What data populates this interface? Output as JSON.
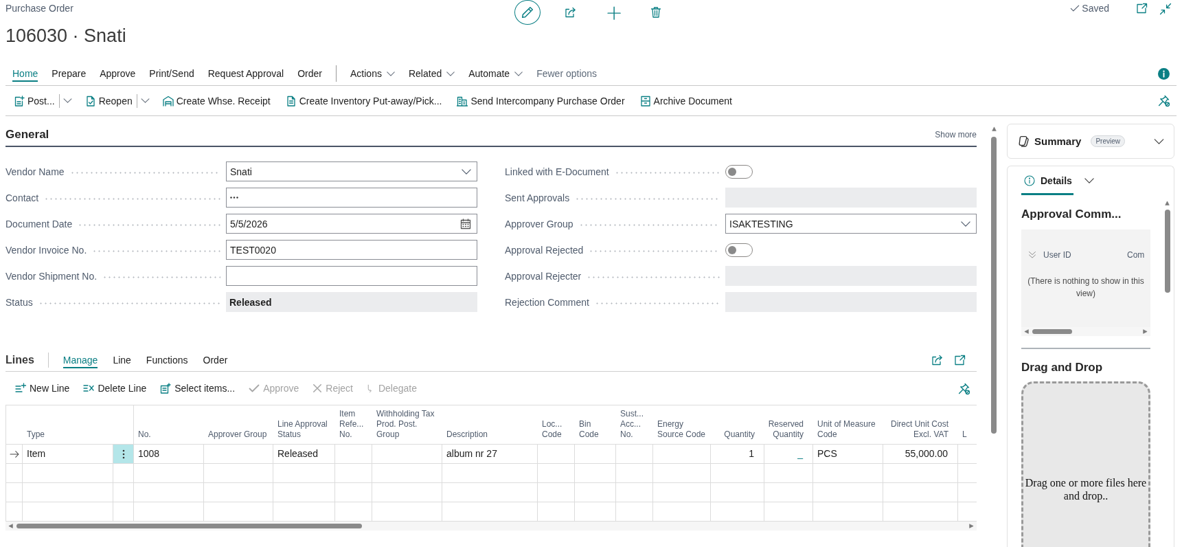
{
  "header": {
    "caption": "Purchase Order",
    "title": "106030 · Snati",
    "save_status": "Saved"
  },
  "tabs": [
    {
      "label": "Home",
      "kind": "tab",
      "selected": true
    },
    {
      "label": "Prepare",
      "kind": "tab",
      "selected": false
    },
    {
      "label": "Approve",
      "kind": "tab",
      "selected": false
    },
    {
      "label": "Print/Send",
      "kind": "tab",
      "selected": false
    },
    {
      "label": "Request Approval",
      "kind": "tab",
      "selected": false
    },
    {
      "label": "Order",
      "kind": "tab",
      "selected": false
    },
    {
      "label": "Actions",
      "kind": "menu",
      "selected": false
    },
    {
      "label": "Related",
      "kind": "menu",
      "selected": false
    },
    {
      "label": "Automate",
      "kind": "menu",
      "selected": false
    },
    {
      "label": "Fewer options",
      "kind": "toggle",
      "selected": false
    }
  ],
  "actions": [
    {
      "label": "Post...",
      "split": true
    },
    {
      "label": "Reopen",
      "split": true
    },
    {
      "label": "Create Whse. Receipt",
      "split": false
    },
    {
      "label": "Create Inventory Put-away/Pick...",
      "split": false
    },
    {
      "label": "Send Intercompany Purchase Order",
      "split": false
    },
    {
      "label": "Archive Document",
      "split": false
    }
  ],
  "general": {
    "title": "General",
    "show_more": "Show more",
    "field_columns": [
      {
        "fields": [
          {
            "label": "Vendor Name",
            "kind": "dropdown",
            "value": "Snati"
          },
          {
            "label": "Contact",
            "kind": "lookup"
          },
          {
            "label": "Document Date",
            "kind": "date",
            "value": "5/5/2026"
          },
          {
            "label": "Vendor Invoice No.",
            "kind": "text",
            "value": "TEST0020"
          },
          {
            "label": "Vendor Shipment No.",
            "kind": "text"
          },
          {
            "label": "Status",
            "kind": "readonly",
            "value": "Released"
          }
        ]
      },
      {
        "fields": [
          {
            "label": "Linked with E-Document",
            "kind": "toggle",
            "on": false
          },
          {
            "label": "Sent Approvals",
            "kind": "readonly"
          },
          {
            "label": "Approver Group",
            "kind": "dropdown",
            "value": "ISAKTESTING"
          },
          {
            "label": "Approval Rejected",
            "kind": "toggle",
            "on": false
          },
          {
            "label": "Approval Rejecter",
            "kind": "readonly"
          },
          {
            "label": "Rejection Comment",
            "kind": "readonly"
          }
        ]
      }
    ]
  },
  "lines": {
    "title": "Lines",
    "tabs": [
      {
        "label": "Manage",
        "selected": true
      },
      {
        "label": "Line",
        "selected": false
      },
      {
        "label": "Functions",
        "selected": false
      },
      {
        "label": "Order",
        "selected": false
      }
    ],
    "actions": [
      {
        "label": "New Line",
        "disabled": false
      },
      {
        "label": "Delete Line",
        "disabled": false
      },
      {
        "label": "Select items...",
        "disabled": false
      },
      {
        "label": "Approve",
        "disabled": true
      },
      {
        "label": "Reject",
        "disabled": true
      },
      {
        "label": "Delegate",
        "disabled": true
      }
    ],
    "columns": [
      {
        "label": "Type",
        "kind": "text"
      },
      {
        "label": "No.",
        "kind": "text"
      },
      {
        "label": "Approver Group",
        "kind": "text"
      },
      {
        "label": "Line Approval Status",
        "kind": "text"
      },
      {
        "label": "Item Refe... No.",
        "kind": "text"
      },
      {
        "label": "Withholding Tax Prod. Post. Group",
        "kind": "text"
      },
      {
        "label": "Description",
        "kind": "text"
      },
      {
        "label": "Loc... Code",
        "kind": "text"
      },
      {
        "label": "Bin Code",
        "kind": "text"
      },
      {
        "label": "Sust... Acc... No.",
        "kind": "text"
      },
      {
        "label": "Energy Source Code",
        "kind": "text"
      },
      {
        "label": "Quantity",
        "kind": "number"
      },
      {
        "label": "Reserved Quantity",
        "kind": "drilldown"
      },
      {
        "label": "Unit of Measure Code",
        "kind": "text"
      },
      {
        "label": "Direct Unit Cost Excl. VAT",
        "kind": "number"
      },
      {
        "label": "L",
        "kind": "text"
      }
    ],
    "rows": [
      {
        "current": true,
        "cells": [
          "Item",
          "1008",
          null,
          "Released",
          null,
          null,
          "album nr 27",
          null,
          null,
          null,
          null,
          "1",
          "_",
          "PCS",
          "55,000.00",
          null
        ]
      },
      {
        "current": false
      },
      {
        "current": false
      },
      {
        "current": false
      }
    ]
  },
  "factbox": {
    "summary": {
      "title": "Summary",
      "badge": "Preview"
    },
    "tabs": [
      {
        "label": "Details",
        "selected": true
      }
    ],
    "approval_comments": {
      "title": "Approval Comm...",
      "columns": [
        "User ID",
        "Com"
      ],
      "empty_message": "(There is nothing to show in this view)"
    },
    "drag_drop": {
      "title": "Drag and Drop",
      "hint": "Drag one or more files here and drop.."
    }
  }
}
